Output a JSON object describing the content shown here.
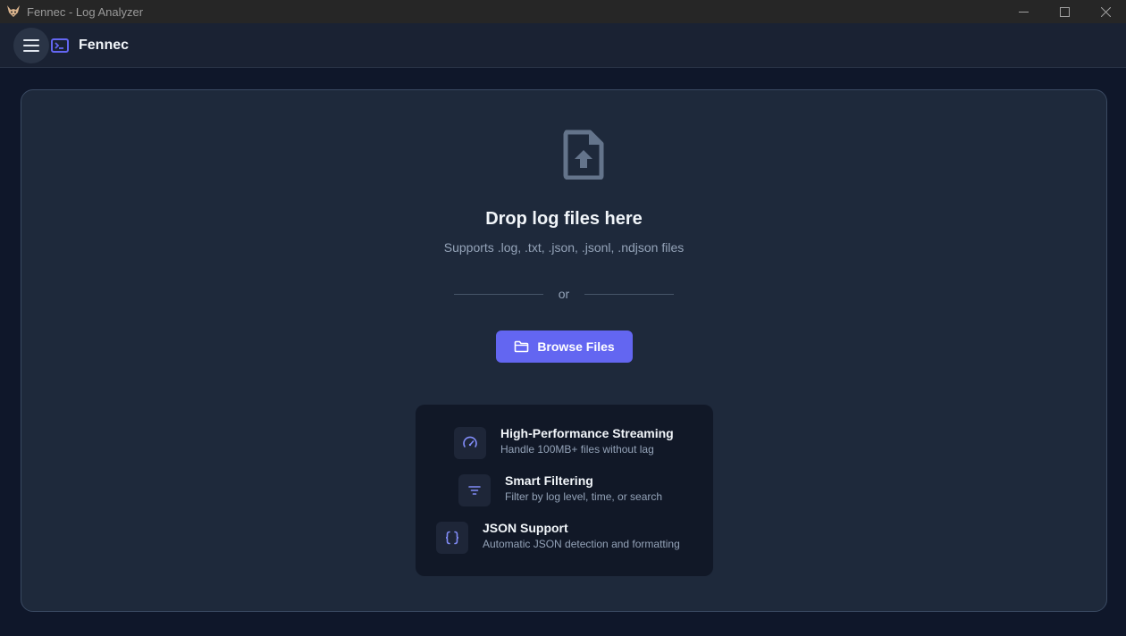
{
  "window": {
    "title": "Fennec - Log Analyzer",
    "controls": [
      "minimize-icon",
      "maximize-icon",
      "close-icon"
    ]
  },
  "header": {
    "brand": "Fennec",
    "menu_icon": "hamburger-menu-icon",
    "brand_icon": "terminal-icon"
  },
  "dropzone": {
    "icon": "file-upload-icon",
    "title": "Drop log files here",
    "subtitle": "Supports .log, .txt, .json, .jsonl, .ndjson files",
    "divider_text": "or",
    "browse_label": "Browse Files"
  },
  "features": [
    {
      "icon": "speedometer-icon",
      "title": "High-Performance Streaming",
      "desc": "Handle 100MB+ files without lag"
    },
    {
      "icon": "filter-icon",
      "title": "Smart Filtering",
      "desc": "Filter by log level, time, or search"
    },
    {
      "icon": "braces-icon",
      "title": "JSON Support",
      "desc": "Automatic JSON detection and formatting"
    }
  ],
  "colors": {
    "accent": "#6366f1",
    "background": "#0f172a",
    "panel": "#1e293b",
    "card": "#111827"
  }
}
